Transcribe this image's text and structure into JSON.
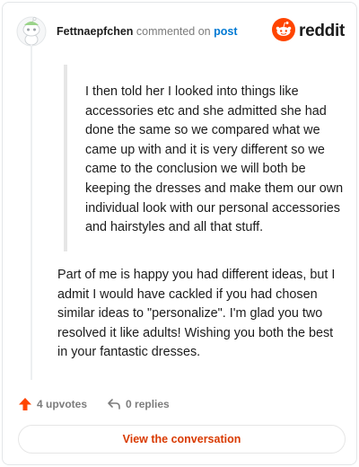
{
  "header": {
    "author": "Fettnaepfchen",
    "commented_on": "commented on",
    "post_link": "post",
    "brand": "reddit"
  },
  "quote": {
    "text": "I then told her I looked into things like accessories etc and she admitted she had done the same so we compared what we came up with and it is very different so we came to the conclusion we will both be keeping the dresses and make them our own individual look with our personal accessories and hairstyles and all that stuff."
  },
  "comment": {
    "text": "Part of me is happy you had different ideas, but I admit I would have cackled if you had chosen similar ideas to \"personalize\". I'm glad you two resolved it like adults! Wishing you both the best in your fantastic dresses."
  },
  "actions": {
    "upvotes": "4 upvotes",
    "replies": "0 replies"
  },
  "cta": {
    "label": "View the conversation"
  },
  "colors": {
    "brand_orange": "#ff4500",
    "link_blue": "#0079d3",
    "cta_text": "#d93a00"
  },
  "icons": [
    "avatar-icon",
    "reddit-logo-icon",
    "upvote-arrow-icon",
    "reply-arrow-icon"
  ]
}
